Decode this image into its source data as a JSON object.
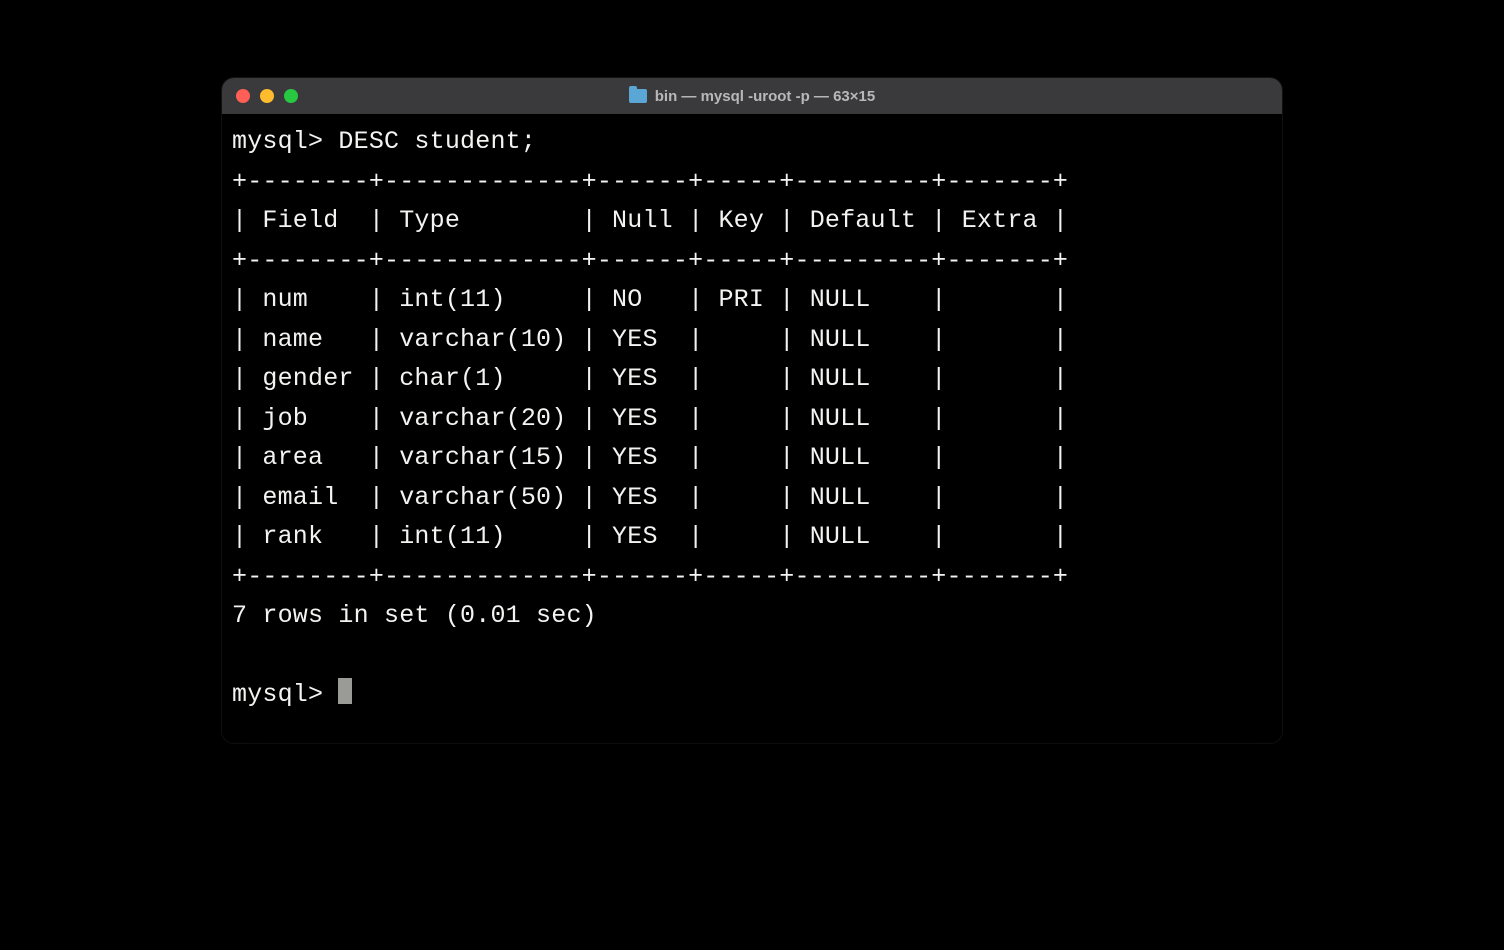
{
  "window": {
    "title": "bin — mysql -uroot -p — 63×15"
  },
  "terminal": {
    "prompt1": "mysql> ",
    "command1": "DESC student;",
    "prompt2": "mysql> ",
    "table": {
      "border_top": "+--------+-------------+------+-----+---------+-------+",
      "header_row": "| Field  | Type        | Null | Key | Default | Extra |",
      "border_mid": "+--------+-------------+------+-----+---------+-------+",
      "rows": [
        "| num    | int(11)     | NO   | PRI | NULL    |       |",
        "| name   | varchar(10) | YES  |     | NULL    |       |",
        "| gender | char(1)     | YES  |     | NULL    |       |",
        "| job    | varchar(20) | YES  |     | NULL    |       |",
        "| area   | varchar(15) | YES  |     | NULL    |       |",
        "| email  | varchar(50) | YES  |     | NULL    |       |",
        "| rank   | int(11)     | YES  |     | NULL    |       |"
      ],
      "border_bot": "+--------+-------------+------+-----+---------+-------+"
    },
    "summary": "7 rows in set (0.01 sec)"
  }
}
